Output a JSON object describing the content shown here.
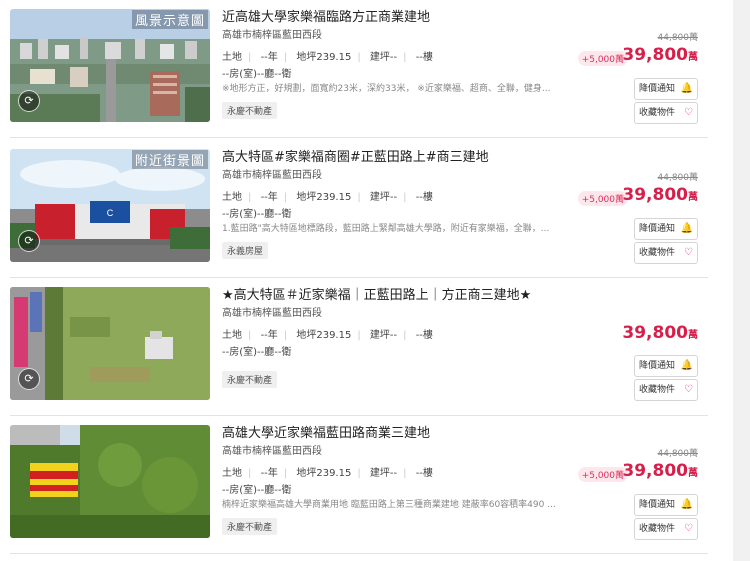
{
  "listings": [
    {
      "title": "近高雄大學家樂福臨路方正商業建地",
      "address": "高雄市楠梓區藍田西段",
      "specs": [
        "土地",
        "--年",
        "地坪239.15",
        "建坪--",
        "--樓"
      ],
      "layout": "--房(室)--廳--衛",
      "description": "※地形方正，好規劃，面寬約23米，深約33米， ※近家樂福、超商、全聯，健身...",
      "agency": "永慶不動產",
      "old_price": "44,800萬",
      "discount": "+5,000萬",
      "price": "39,800",
      "price_unit": "萬",
      "btn_notify": "降價通知",
      "btn_fav": "收藏物件",
      "watermark": "風景示意圖"
    },
    {
      "title": "高大特區#家樂福商圈#正藍田路上#商三建地",
      "address": "高雄市楠梓區藍田西段",
      "specs": [
        "土地",
        "--年",
        "地坪239.15",
        "建坪--",
        "--樓"
      ],
      "layout": "--房(室)--廳--衛",
      "description": "1.藍田路\"高大特區地標路段，藍田路上緊鄰高雄大學路，附近有家樂福，全聯，...",
      "agency": "永義房屋",
      "old_price": "44,800萬",
      "discount": "+5,000萬",
      "price": "39,800",
      "price_unit": "萬",
      "btn_notify": "降價通知",
      "btn_fav": "收藏物件",
      "watermark": "附近街景圖"
    },
    {
      "title": "★高大特區＃近家樂福｜正藍田路上｜方正商三建地★",
      "address": "高雄市楠梓區藍田西段",
      "specs": [
        "土地",
        "--年",
        "地坪239.15",
        "建坪--",
        "--樓"
      ],
      "layout": "--房(室)--廳--衛",
      "description": "",
      "agency": "永慶不動產",
      "old_price": "",
      "discount": "",
      "price": "39,800",
      "price_unit": "萬",
      "btn_notify": "降價通知",
      "btn_fav": "收藏物件",
      "watermark": ""
    },
    {
      "title": "高雄大學近家樂福藍田路商業三建地",
      "address": "高雄市楠梓區藍田西段",
      "specs": [
        "土地",
        "--年",
        "地坪239.15",
        "建坪--",
        "--樓"
      ],
      "layout": "--房(室)--廳--衛",
      "description": "楠梓近家樂福高雄大學商業用地 臨藍田路上第三種商業建地 建蔽率60容積率490 ...",
      "agency": "永慶不動產",
      "old_price": "44,800萬",
      "discount": "+5,000萬",
      "price": "39,800",
      "price_unit": "萬",
      "btn_notify": "降價通知",
      "btn_fav": "收藏物件",
      "watermark": ""
    }
  ],
  "icons": {
    "notify": "bell-icon",
    "favorite": "heart-icon",
    "photo_badge": "view-360-icon"
  },
  "colors": {
    "price": "#d6204b",
    "discount_bg": "#fde7ec"
  }
}
